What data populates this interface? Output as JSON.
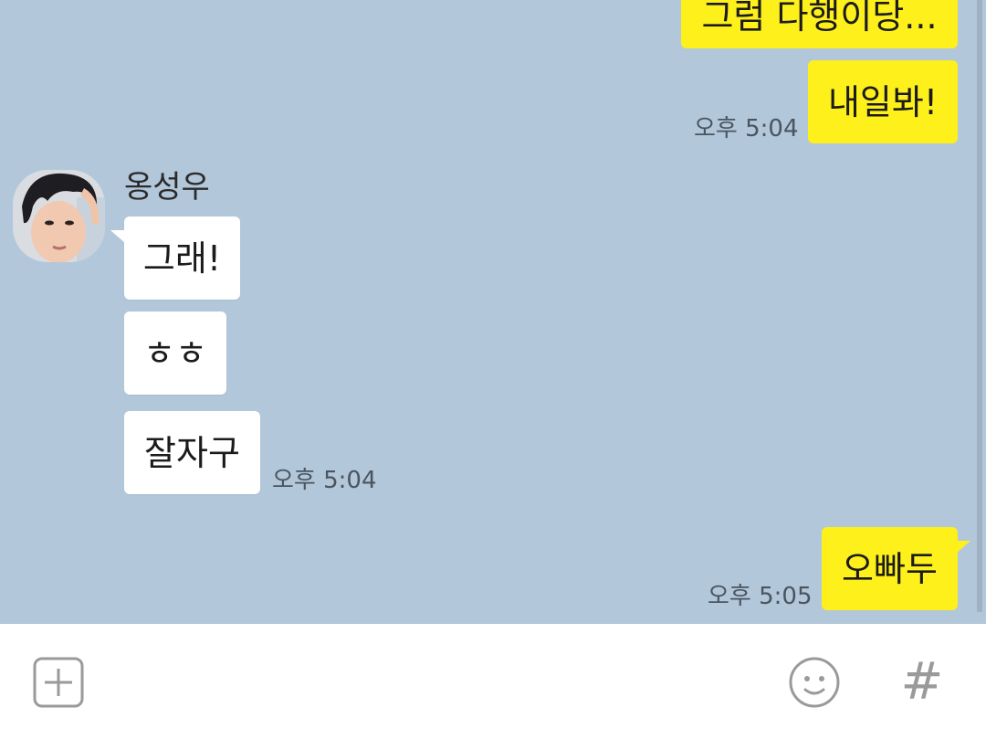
{
  "messages": [
    {
      "id": "m1",
      "from": "me",
      "text": "그럼 다행이당..."
    },
    {
      "id": "m2",
      "from": "me",
      "text": "내일봐!",
      "time": "오후 5:04"
    },
    {
      "id": "m3",
      "from": "other",
      "text": "그래!"
    },
    {
      "id": "m4",
      "from": "other",
      "text": "ㅎㅎ"
    },
    {
      "id": "m5",
      "from": "other",
      "text": "잘자구",
      "time": "오후 5:04"
    },
    {
      "id": "m6",
      "from": "me",
      "text": "오빠두",
      "time": "오후 5:05"
    }
  ],
  "contact": {
    "name": "옹성우"
  },
  "input_bar": {
    "add_icon": "plus-square-icon",
    "emoji_icon": "smiley-icon",
    "hash_label": "#"
  },
  "colors": {
    "chat_background": "#b2c7da",
    "my_bubble": "#fef01b",
    "their_bubble": "#ffffff",
    "input_background": "#ffffff",
    "icon_gray": "#9a9a9a"
  }
}
